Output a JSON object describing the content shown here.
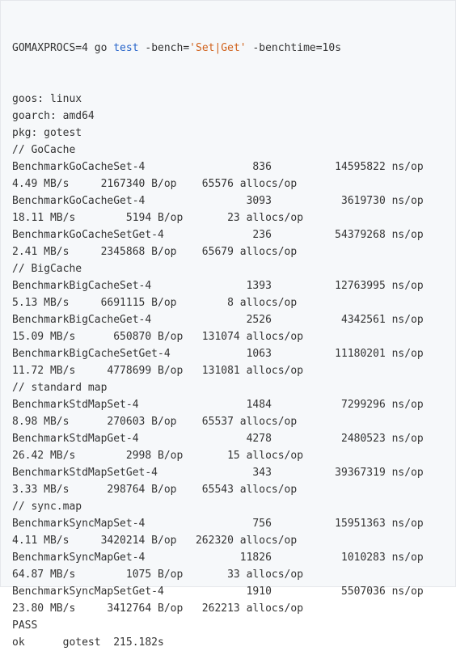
{
  "colors": {
    "background": "#f6f8fa",
    "text": "#333333",
    "keyword": "#2563c9",
    "string": "#d0611b"
  },
  "command": {
    "env": "GOMAXPROCS=4 go ",
    "keyword": "test",
    "flag_bench": " -bench=",
    "bench_pattern": "'Set|Get'",
    "flag_benchtime": " -benchtime=10s"
  },
  "lines": [
    "goos: linux",
    "goarch: amd64",
    "pkg: gotest",
    "// GoCache",
    "BenchmarkGoCacheSet-4                 836          14595822 ns/op",
    "4.49 MB/s     2167340 B/op    65576 allocs/op",
    "BenchmarkGoCacheGet-4                3093           3619730 ns/op",
    "18.11 MB/s        5194 B/op       23 allocs/op",
    "BenchmarkGoCacheSetGet-4              236          54379268 ns/op",
    "2.41 MB/s     2345868 B/op    65679 allocs/op",
    "// BigCache",
    "BenchmarkBigCacheSet-4               1393          12763995 ns/op",
    "5.13 MB/s     6691115 B/op        8 allocs/op",
    "BenchmarkBigCacheGet-4               2526           4342561 ns/op",
    "15.09 MB/s      650870 B/op   131074 allocs/op",
    "BenchmarkBigCacheSetGet-4            1063          11180201 ns/op",
    "11.72 MB/s     4778699 B/op   131081 allocs/op",
    "// standard map",
    "BenchmarkStdMapSet-4                 1484           7299296 ns/op",
    "8.98 MB/s      270603 B/op    65537 allocs/op",
    "BenchmarkStdMapGet-4                 4278           2480523 ns/op",
    "26.42 MB/s        2998 B/op       15 allocs/op",
    "BenchmarkStdMapSetGet-4               343          39367319 ns/op",
    "3.33 MB/s      298764 B/op    65543 allocs/op",
    "// sync.map",
    "BenchmarkSyncMapSet-4                 756          15951363 ns/op",
    "4.11 MB/s     3420214 B/op   262320 allocs/op",
    "BenchmarkSyncMapGet-4               11826           1010283 ns/op",
    "64.87 MB/s        1075 B/op       33 allocs/op",
    "BenchmarkSyncMapSetGet-4             1910           5507036 ns/op",
    "23.80 MB/s     3412764 B/op   262213 allocs/op",
    "PASS",
    "ok      gotest  215.182s"
  ]
}
